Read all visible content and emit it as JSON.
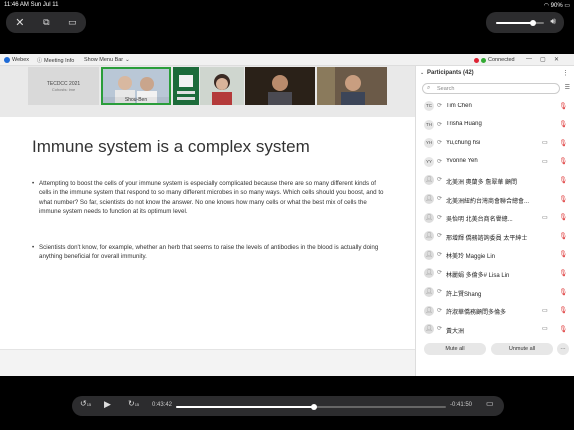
{
  "status_bar": {
    "time_date": "11:46 AM  Sun Jul 11",
    "battery": "90%"
  },
  "top_controls": {
    "close": "✕",
    "pip": "⧉",
    "airplay": "▭"
  },
  "volume": {
    "level": 0.78
  },
  "menu_bar": {
    "app_name": "Webex",
    "meeting_info": "Meeting Info",
    "show_menu_bar": "Show Menu Bar",
    "connection": "Connected"
  },
  "video_strip": {
    "tiles": [
      {
        "label": "TECDCC 2021",
        "sublabel": "Cohosts: ime"
      },
      {
        "name": "Shou-Ben"
      },
      {
        "name": ""
      },
      {
        "name": ""
      },
      {
        "name": ""
      },
      {
        "name": ""
      }
    ]
  },
  "slide": {
    "title": "Immune system is a complex system",
    "bullets": [
      "Attempting to boost the cells of your immune system is especially complicated because there are so many different kinds of cells in the immune system that respond to so many different microbes in so many ways. Which cells should you boost, and to what number? So far, scientists do not know the answer. No one knows how many cells or what the best mix of cells the immune system needs to function at its optimum level.",
      "Scientists don't know, for example, whether an herb that seems to raise the levels of antibodies in the blood is actually doing anything beneficial for overall immunity."
    ]
  },
  "participants": {
    "title": "Participants (42)",
    "search_placeholder": "Search",
    "items": [
      {
        "avatar": "TC",
        "name": "Tim Chen",
        "camera": false
      },
      {
        "avatar": "TH",
        "name": "Trisha Huang",
        "camera": false
      },
      {
        "avatar": "YH",
        "name": "Yu,chung hsi",
        "camera": true
      },
      {
        "avatar": "YY",
        "name": "Yvonne Yeh",
        "camera": true
      },
      {
        "avatar": "",
        "name": "北美洲 奧蘭多 詹翠華 顧問",
        "camera": false
      },
      {
        "avatar": "",
        "name": "北美洲紐約台灣商會聯合總會...",
        "camera": false
      },
      {
        "avatar": "",
        "name": "吳怡明 北美台商名譽總...",
        "camera": true
      },
      {
        "avatar": "",
        "name": "邢增輝 僑務諮詢委員 太平紳士",
        "camera": false
      },
      {
        "avatar": "",
        "name": "林美玲 Maggie Lin",
        "camera": false
      },
      {
        "avatar": "",
        "name": "林麗娟 多倫多# Lisa Lin",
        "camera": false
      },
      {
        "avatar": "",
        "name": "許上賢Shang",
        "camera": false
      },
      {
        "avatar": "",
        "name": "許淑華僑務顧問多倫多",
        "camera": true
      },
      {
        "avatar": "",
        "name": "黃大洲",
        "camera": true
      }
    ],
    "mute_all": "Mute all",
    "unmute_all": "Unmute all",
    "more": "···"
  },
  "player": {
    "elapsed": "0:43:42",
    "remaining": "-0:41:50",
    "progress": 0.51,
    "skip_back": "15",
    "skip_forward": "15"
  }
}
